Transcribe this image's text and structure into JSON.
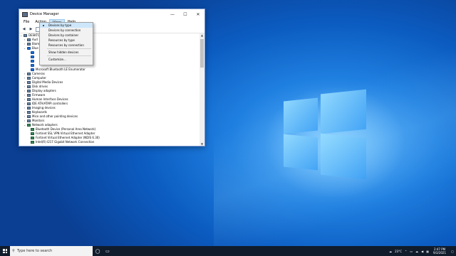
{
  "window": {
    "title": "Device Manager",
    "minimize": "—",
    "maximize": "☐",
    "close": "✕"
  },
  "menubar": {
    "file": "File",
    "action": "Action",
    "view": "View",
    "help": "Help"
  },
  "view_menu": {
    "items": [
      "Devices by type",
      "Devices by connection",
      "Devices by container",
      "Resources by type",
      "Resources by connection"
    ],
    "selected": "Devices by type",
    "show_hidden": "Show hidden devices",
    "customize": "Customize..."
  },
  "tree": {
    "root": "DESKTO",
    "rows": [
      {
        "label": "Aud",
        "indent": 1,
        "caret": "›",
        "icon": "device"
      },
      {
        "label": "Biom",
        "indent": 1,
        "caret": "›",
        "icon": "device"
      },
      {
        "label": "Blue",
        "indent": 1,
        "caret": "⌄",
        "icon": "bt"
      },
      {
        "label": "",
        "indent": 2,
        "caret": "",
        "icon": "bt"
      },
      {
        "label": "",
        "indent": 2,
        "caret": "",
        "icon": "bt"
      },
      {
        "label": "",
        "indent": 2,
        "caret": "",
        "icon": "bt"
      },
      {
        "label": "",
        "indent": 2,
        "caret": "",
        "icon": "bt"
      },
      {
        "label": "Microsoft Bluetooth LE Enumerator",
        "indent": 2,
        "caret": "",
        "icon": "bt"
      },
      {
        "label": "Cameras",
        "indent": 1,
        "caret": "›",
        "icon": "device"
      },
      {
        "label": "Computer",
        "indent": 1,
        "caret": "›",
        "icon": "device"
      },
      {
        "label": "Digital Media Devices",
        "indent": 1,
        "caret": "›",
        "icon": "device"
      },
      {
        "label": "Disk drives",
        "indent": 1,
        "caret": "›",
        "icon": "device"
      },
      {
        "label": "Display adapters",
        "indent": 1,
        "caret": "›",
        "icon": "device"
      },
      {
        "label": "Firmware",
        "indent": 1,
        "caret": "›",
        "icon": "device"
      },
      {
        "label": "Human Interface Devices",
        "indent": 1,
        "caret": "›",
        "icon": "device"
      },
      {
        "label": "IDE ATA/ATAPI controllers",
        "indent": 1,
        "caret": "›",
        "icon": "device"
      },
      {
        "label": "Imaging devices",
        "indent": 1,
        "caret": "›",
        "icon": "device"
      },
      {
        "label": "Keyboards",
        "indent": 1,
        "caret": "›",
        "icon": "device"
      },
      {
        "label": "Mice and other pointing devices",
        "indent": 1,
        "caret": "›",
        "icon": "device"
      },
      {
        "label": "Monitors",
        "indent": 1,
        "caret": "›",
        "icon": "device"
      },
      {
        "label": "Network adapters",
        "indent": 1,
        "caret": "⌄",
        "icon": "net"
      },
      {
        "label": "Bluetooth Device (Personal Area Network)",
        "indent": 2,
        "caret": "",
        "icon": "net"
      },
      {
        "label": "Fortinet SSL VPN Virtual Ethernet Adapter",
        "indent": 2,
        "caret": "",
        "icon": "net"
      },
      {
        "label": "Fortinet Virtual Ethernet Adapter (NDIS 6.30)",
        "indent": 2,
        "caret": "",
        "icon": "net"
      },
      {
        "label": "Intel(R) I217 Gigabit Network Connection",
        "indent": 2,
        "caret": "",
        "icon": "net"
      }
    ]
  },
  "taskbar": {
    "search_placeholder": "Type here to search",
    "weather": "23°C",
    "time": "2:47 PM",
    "date": "9/3/2021"
  }
}
